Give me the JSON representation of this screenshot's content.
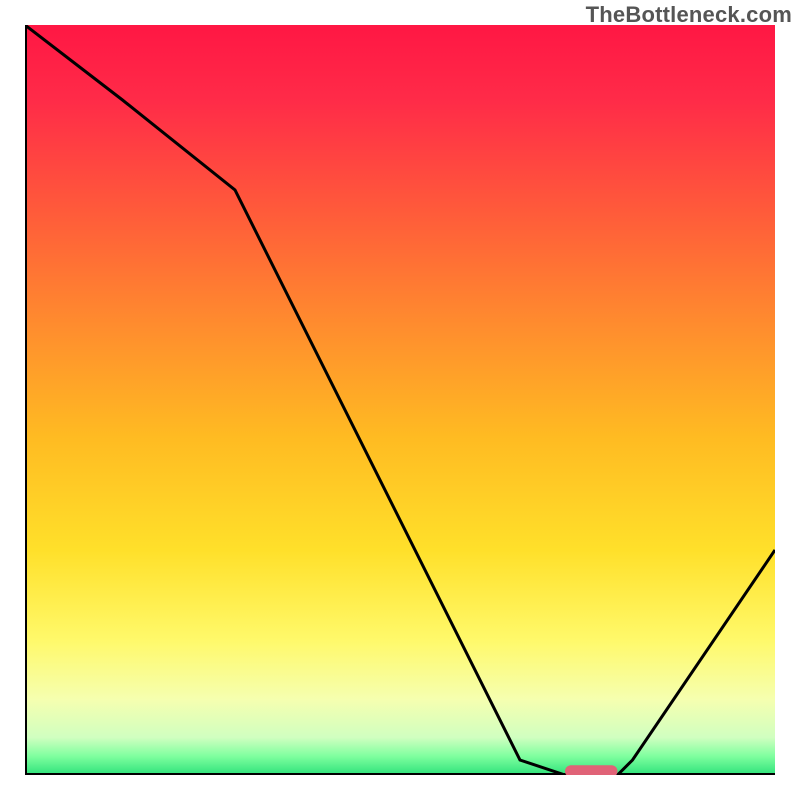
{
  "watermark": "TheBottleneck.com",
  "chart_data": {
    "type": "line",
    "title": "",
    "xlabel": "",
    "ylabel": "",
    "xlim": [
      0,
      100
    ],
    "ylim": [
      0,
      100
    ],
    "grid": false,
    "legend": false,
    "series": [
      {
        "name": "bottleneck-curve",
        "x": [
          0,
          13,
          28,
          66,
          72,
          79,
          81,
          100
        ],
        "values": [
          100,
          90,
          78,
          2,
          0,
          0,
          2,
          30
        ]
      }
    ],
    "marker": {
      "x_start": 72,
      "x_end": 79,
      "y": 0.5,
      "color": "#e06377"
    },
    "gradient_stops": [
      {
        "offset": 0.0,
        "color": "#ff1744"
      },
      {
        "offset": 0.1,
        "color": "#ff2b48"
      },
      {
        "offset": 0.25,
        "color": "#ff5b3a"
      },
      {
        "offset": 0.4,
        "color": "#ff8c2e"
      },
      {
        "offset": 0.55,
        "color": "#ffbb22"
      },
      {
        "offset": 0.7,
        "color": "#ffe02a"
      },
      {
        "offset": 0.82,
        "color": "#fff96a"
      },
      {
        "offset": 0.9,
        "color": "#f5ffb0"
      },
      {
        "offset": 0.95,
        "color": "#d0ffc0"
      },
      {
        "offset": 0.975,
        "color": "#7fff9f"
      },
      {
        "offset": 1.0,
        "color": "#2ee27a"
      }
    ],
    "axis_color": "#000000",
    "line_color": "#000000",
    "line_width": 3
  }
}
